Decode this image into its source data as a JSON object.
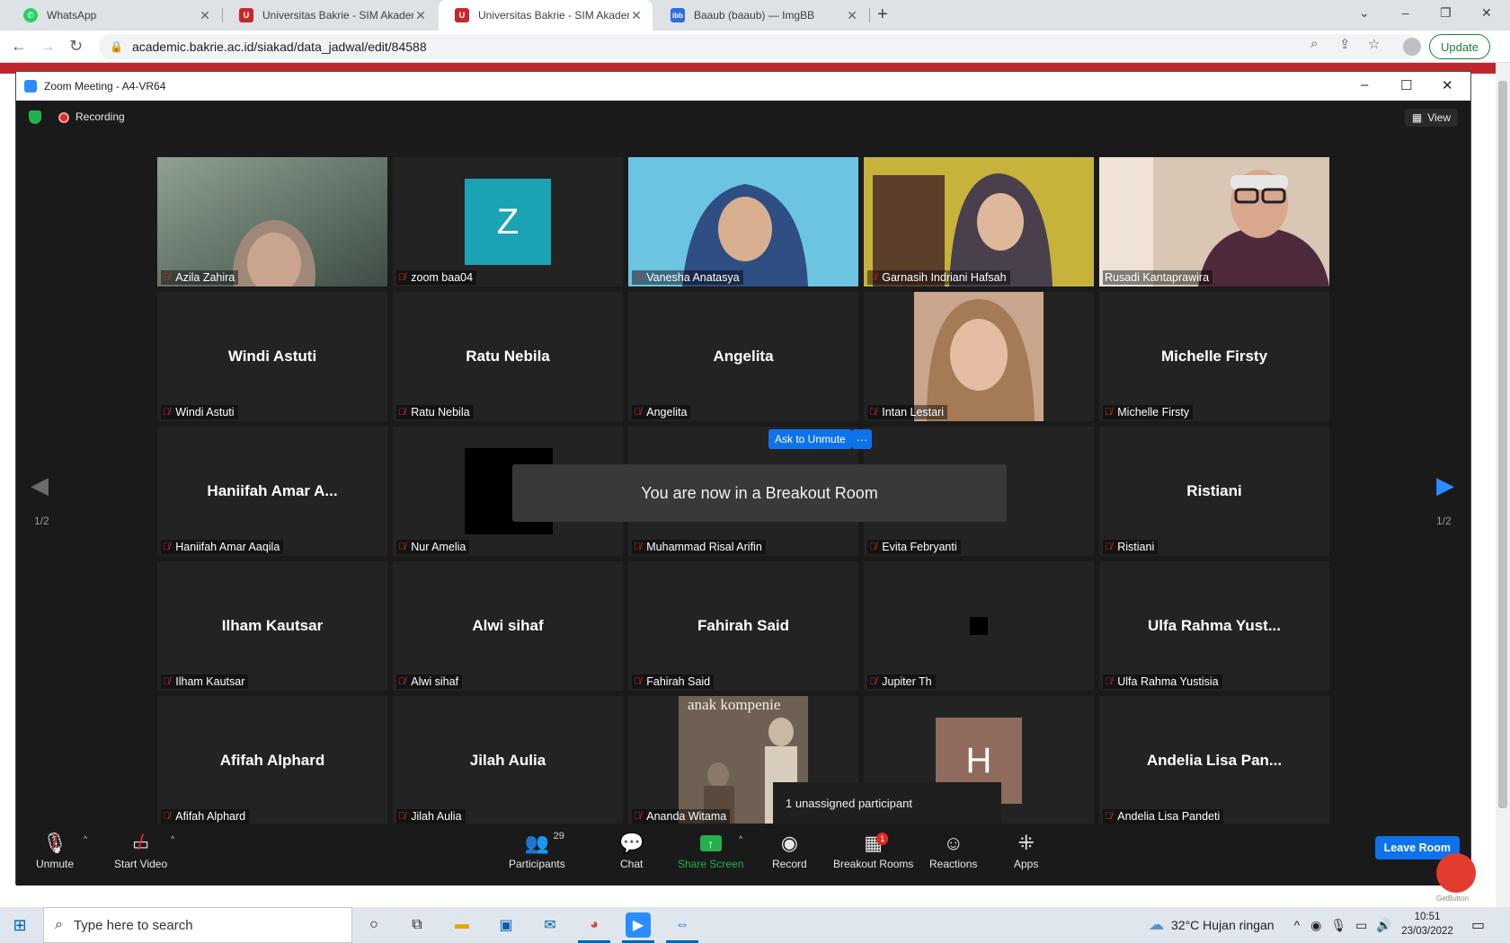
{
  "browser": {
    "tabs": [
      {
        "title": "WhatsApp",
        "favicon": "whatsapp-icon",
        "active": false
      },
      {
        "title": "Universitas Bakrie - SIM Akadem",
        "favicon": "ubakrie-icon",
        "active": false
      },
      {
        "title": "Universitas Bakrie - SIM Akadem",
        "favicon": "ubakrie-icon",
        "active": true
      },
      {
        "title": "Baaub (baaub) — ImgBB",
        "favicon": "imgbb-icon",
        "active": false
      }
    ],
    "url": "academic.bakrie.ac.id/siakad/data_jadwal/edit/84588",
    "update_label": "Update"
  },
  "zoom": {
    "window_title": "Zoom Meeting - A4-VR64",
    "recording_label": "Recording",
    "view_label": "View",
    "page_indicator": "1/2",
    "breakout_message": "You are now in a Breakout Room",
    "ask_unmute_label": "Ask to Unmute",
    "more_label": "···",
    "unassigned_popup": "1 unassigned participant",
    "participants": [
      {
        "name": "Azila Zahira",
        "display": "video"
      },
      {
        "name": "zoom baa04",
        "display": "avatar",
        "initial": "Z",
        "color": "#1aa3b5"
      },
      {
        "name": "Vanesha Anatasya",
        "display": "video"
      },
      {
        "name": "Garnasih Indriani Hafsah",
        "display": "video"
      },
      {
        "name": "Rusadi Kantaprawira",
        "display": "video",
        "speaking": true
      },
      {
        "name": "Windi Astuti",
        "big": "Windi Astuti"
      },
      {
        "name": "Ratu Nebila",
        "big": "Ratu Nebila"
      },
      {
        "name": "Angelita",
        "big": "Angelita"
      },
      {
        "name": "Intan Lestari",
        "display": "photo"
      },
      {
        "name": "Michelle Firsty",
        "big": "Michelle Firsty"
      },
      {
        "name": "Haniifah Amar Aaqila",
        "big": "Haniifah Amar A..."
      },
      {
        "name": "Nur Amelia",
        "display": "black-box"
      },
      {
        "name": "Muhammad Risal Arifin",
        "big": ""
      },
      {
        "name": "Evita Febryanti",
        "big": ""
      },
      {
        "name": "Ristiani",
        "big": "Ristiani"
      },
      {
        "name": "Ilham Kautsar",
        "big": "Ilham Kautsar"
      },
      {
        "name": "Alwi sihaf",
        "big": "Alwi sihaf"
      },
      {
        "name": "Fahirah Said",
        "big": "Fahirah Said"
      },
      {
        "name": "Jupiter Th",
        "display": "small-black"
      },
      {
        "name": "Ulfa Rahma Yustisia",
        "big": "Ulfa Rahma Yust..."
      },
      {
        "name": "Afifah Alphard",
        "big": "Afifah Alphard"
      },
      {
        "name": "Jilah Aulia",
        "big": "Jilah Aulia"
      },
      {
        "name": "Ananda Witama",
        "display": "book-cover",
        "cover_text": "anak kompenie"
      },
      {
        "name": "",
        "display": "avatar",
        "initial": "H",
        "color": "#8e6b5c"
      },
      {
        "name": "Andelia Lisa Pandeti",
        "big": "Andelia Lisa Pan..."
      }
    ],
    "controls": {
      "unmute": "Unmute",
      "start_video": "Start Video",
      "participants": "Participants",
      "participants_count": "29",
      "chat": "Chat",
      "share_screen": "Share Screen",
      "record": "Record",
      "breakout_rooms": "Breakout Rooms",
      "breakout_badge": "1",
      "reactions": "Reactions",
      "apps": "Apps",
      "leave_room": "Leave Room"
    }
  },
  "getbutton_label": "GetButton",
  "taskbar": {
    "search_placeholder": "Type here to search",
    "weather": "32°C  Hujan ringan",
    "time": "10:51",
    "date": "23/03/2022"
  },
  "colors": {
    "zoom_blue": "#0e72ed",
    "mic_off_red": "#e02828",
    "speaking_outline": "#e8e35a",
    "share_green": "#23b14d"
  }
}
